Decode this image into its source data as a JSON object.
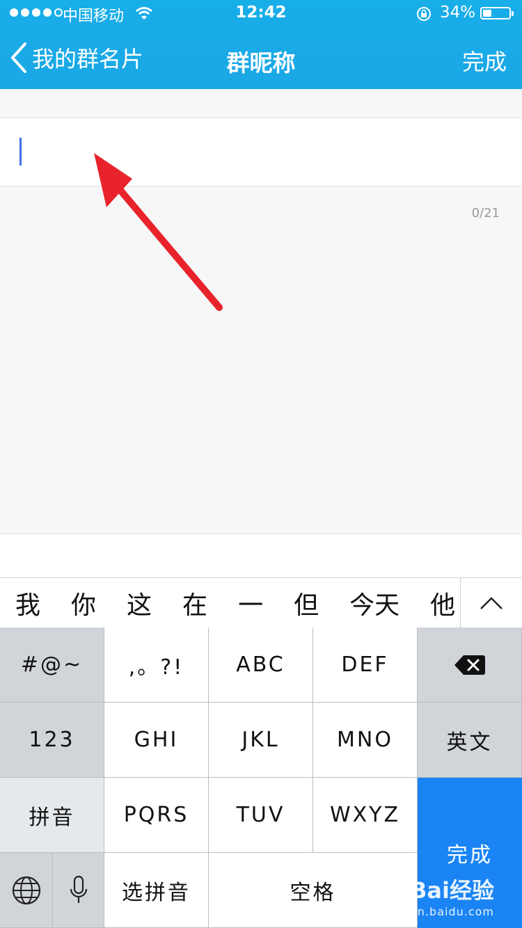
{
  "status_bar": {
    "carrier": "中国移动",
    "time": "12:42",
    "battery_percent": "34%",
    "battery_level": 0.34
  },
  "nav": {
    "back_label": "我的群名片",
    "title": "群昵称",
    "done_label": "完成"
  },
  "input": {
    "value": "",
    "counter": "0/21"
  },
  "suggestions": [
    "我",
    "你",
    "这",
    "在",
    "一",
    "但",
    "今天",
    "他"
  ],
  "keyboard": {
    "symbols": "#@~",
    "punct": ",。?!",
    "abc": "ABC",
    "def": "DEF",
    "num": "123",
    "ghi": "GHI",
    "jkl": "JKL",
    "mno": "MNO",
    "english": "英文",
    "pinyin": "拼音",
    "pqrs": "PQRS",
    "tuv": "TUV",
    "wxyz": "WXYZ",
    "select_pinyin": "选拼音",
    "space": "空格",
    "done": "完成"
  },
  "watermark": {
    "brand": "Bai经验",
    "url": "jingyan.baidu.com"
  },
  "colors": {
    "nav_blue": "#1aaae8",
    "done_key_blue": "#1a84f4",
    "caret_blue": "#3f70e8",
    "annotation_red": "#e8232b"
  },
  "icons": [
    "wifi-icon",
    "rotation-lock-icon",
    "battery-icon",
    "back-chevron-icon",
    "delete-icon",
    "globe-icon",
    "microphone-icon",
    "expand-up-icon"
  ]
}
